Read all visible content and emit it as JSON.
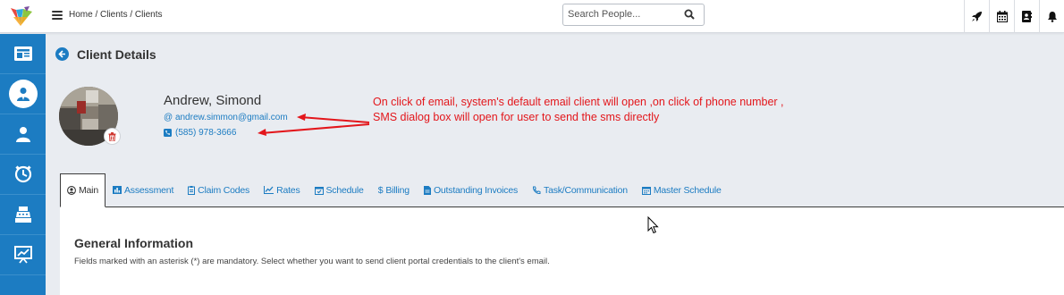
{
  "header": {
    "breadcrumb": "Home / Clients / Clients",
    "search_placeholder": "Search People...",
    "icons": [
      "rocket-icon",
      "calendar-icon",
      "contacts-icon",
      "bell-icon"
    ]
  },
  "sidebar": {
    "items": [
      {
        "name": "dashboard",
        "icon": "newspaper-icon",
        "active": false
      },
      {
        "name": "clients",
        "icon": "user-icon",
        "active": true
      },
      {
        "name": "staff",
        "icon": "user-icon",
        "active": false
      },
      {
        "name": "timesheet",
        "icon": "clock-icon",
        "active": false
      },
      {
        "name": "billing",
        "icon": "cash-register-icon",
        "active": false
      },
      {
        "name": "reports",
        "icon": "presentation-icon",
        "active": false
      }
    ]
  },
  "page": {
    "title": "Client Details"
  },
  "client": {
    "name": "Andrew, Simond",
    "email": "andrew.simmon@gmail.com",
    "phone": "(585) 978-3666"
  },
  "annotation": {
    "line1": "On click of email, system's default email client will open ,on click of phone number ,",
    "line2": "SMS dialog box will open for user to send the sms directly"
  },
  "tabs": [
    {
      "label": "Main",
      "icon": "user-circle-icon",
      "active": true
    },
    {
      "label": "Assessment",
      "icon": "bar-chart-icon",
      "active": false
    },
    {
      "label": "Claim Codes",
      "icon": "clipboard-icon",
      "active": false
    },
    {
      "label": "Rates",
      "icon": "line-chart-icon",
      "active": false
    },
    {
      "label": "Schedule",
      "icon": "calendar-check-icon",
      "active": false
    },
    {
      "label": "Billing",
      "icon": "dollar-icon",
      "active": false
    },
    {
      "label": "Outstanding Invoices",
      "icon": "file-icon",
      "active": false
    },
    {
      "label": "Task/Communication",
      "icon": "phone-icon",
      "active": false
    },
    {
      "label": "Master Schedule",
      "icon": "calendar-icon",
      "active": false
    }
  ],
  "section": {
    "title": "General Information",
    "description": "Fields marked with an asterisk (*) are mandatory. Select whether you want to send client portal credentials to the client's email."
  },
  "colors": {
    "brand_blue": "#1c7cc2",
    "annotation_red": "#e3161b"
  }
}
